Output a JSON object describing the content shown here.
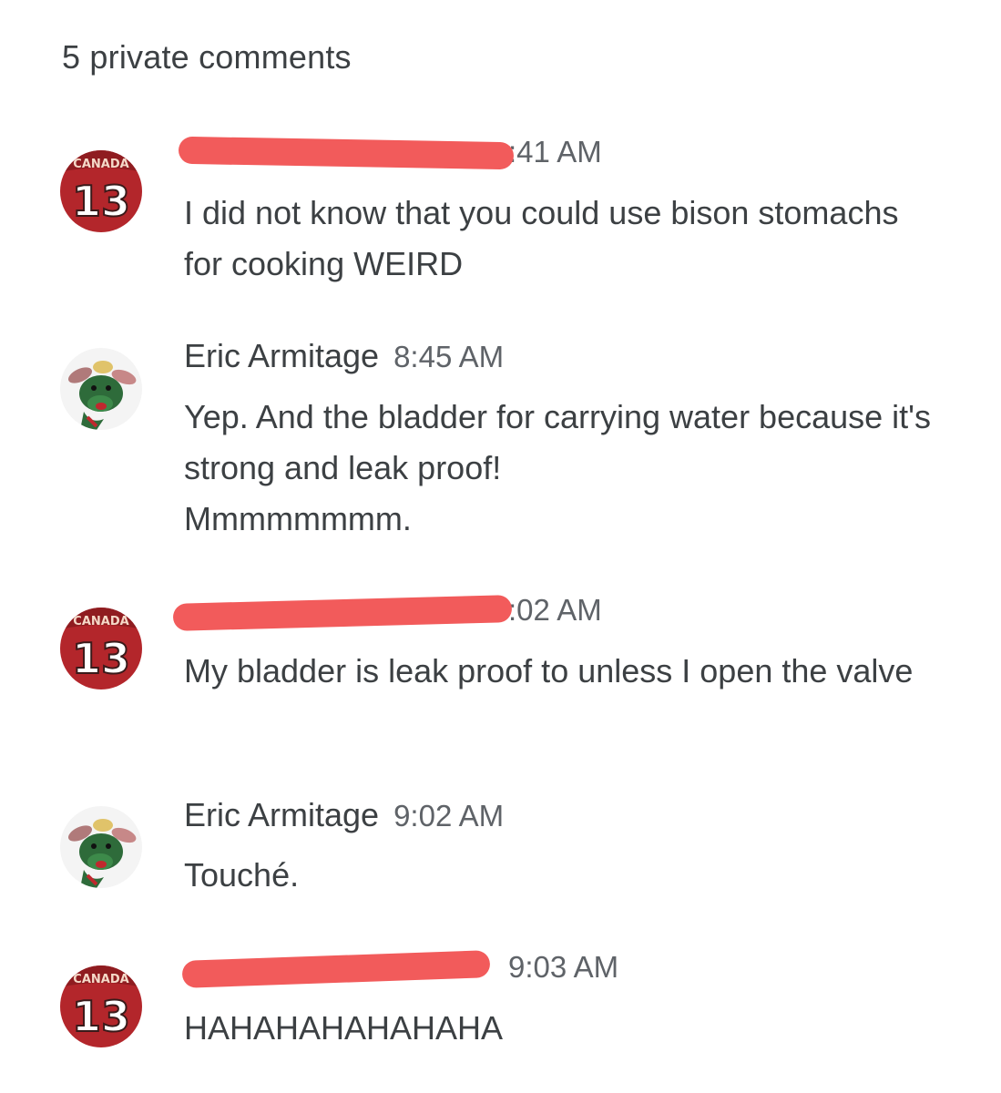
{
  "header": {
    "title": "5 private comments"
  },
  "icons": {
    "jersey_avatar": "jersey-13-avatar-icon",
    "moose_avatar": "green-moose-avatar-icon"
  },
  "colors": {
    "redaction": "#f25b5b",
    "jersey_red": "#b3262b",
    "moose_green": "#2e6b3a"
  },
  "comments": [
    {
      "author": "",
      "time": ":41 AM",
      "text": "I did not know that you could use bison stomachs for cooking WEIRD",
      "avatar_text": "13",
      "avatar_banner": "CANADA"
    },
    {
      "author": "Eric Armitage",
      "time": "8:45 AM",
      "text": "Yep. And the bladder for carrying water because it's strong and leak proof!\nMmmmmmmm."
    },
    {
      "author": "",
      "time": ":02 AM",
      "text": "My bladder is leak proof to unless I open the valve",
      "avatar_text": "13",
      "avatar_banner": "CANADA"
    },
    {
      "author": "Eric Armitage",
      "time": "9:02 AM",
      "text": "Touché."
    },
    {
      "author": "",
      "time": "9:03 AM",
      "text": "HAHAHAHAHAHAHA",
      "avatar_text": "13",
      "avatar_banner": "CANADA"
    }
  ]
}
